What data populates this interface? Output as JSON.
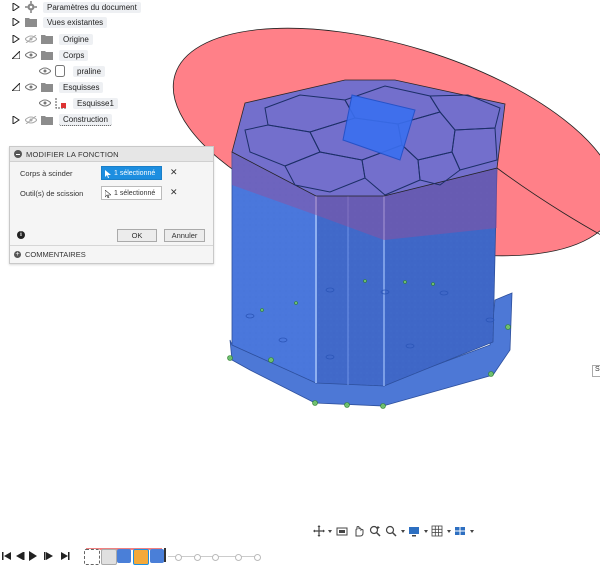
{
  "browser": {
    "items": [
      {
        "label": "Paramètres du document",
        "icon": "gear-icon",
        "toggle": "collapsed",
        "eye": false
      },
      {
        "label": "Vues existantes",
        "icon": "folder-icon",
        "toggle": "collapsed",
        "eye": false
      },
      {
        "label": "Origine",
        "icon": "folder-icon",
        "toggle": "collapsed",
        "eye": true
      },
      {
        "label": "Corps",
        "icon": "folder-icon",
        "toggle": "expanded",
        "eye": true
      },
      {
        "label": "praline",
        "icon": "body-icon",
        "toggle": "none",
        "eye": true
      },
      {
        "label": "Esquisses",
        "icon": "folder-icon",
        "toggle": "expanded",
        "eye": true
      },
      {
        "label": "Esquisse1",
        "icon": "sketch-icon",
        "toggle": "none",
        "eye": true
      },
      {
        "label": "Construction",
        "icon": "folder-icon",
        "toggle": "collapsed",
        "eye": true
      }
    ]
  },
  "dialog": {
    "title": "MODIFIER LA FONCTION",
    "rows": [
      {
        "label": "Corps à scinder",
        "value": "1 sélectionné",
        "active": true
      },
      {
        "label": "Outil(s) de scission",
        "value": "1 sélectionné",
        "active": false
      }
    ],
    "ok_label": "OK",
    "cancel_label": "Annuler",
    "comments_label": "COMMENTAIRES",
    "info_glyph": "i",
    "clear_glyph": "✕"
  },
  "side_tab_text": "Se",
  "colors": {
    "body_blue": "#3f72d8",
    "plane_red": "#ff7f86",
    "select_blue": "#1d8ee0",
    "sketch_green": "#3fa63f"
  },
  "navbar": {
    "icons": [
      "orbit-icon",
      "look-at-icon",
      "pan-icon",
      "zoom-icon",
      "zoom-window-icon",
      "display-settings-icon",
      "grid-icon",
      "viewports-icon"
    ]
  },
  "timeline": {
    "controls": [
      "first-icon",
      "previous-icon",
      "play-icon",
      "next-icon",
      "last-icon"
    ]
  }
}
